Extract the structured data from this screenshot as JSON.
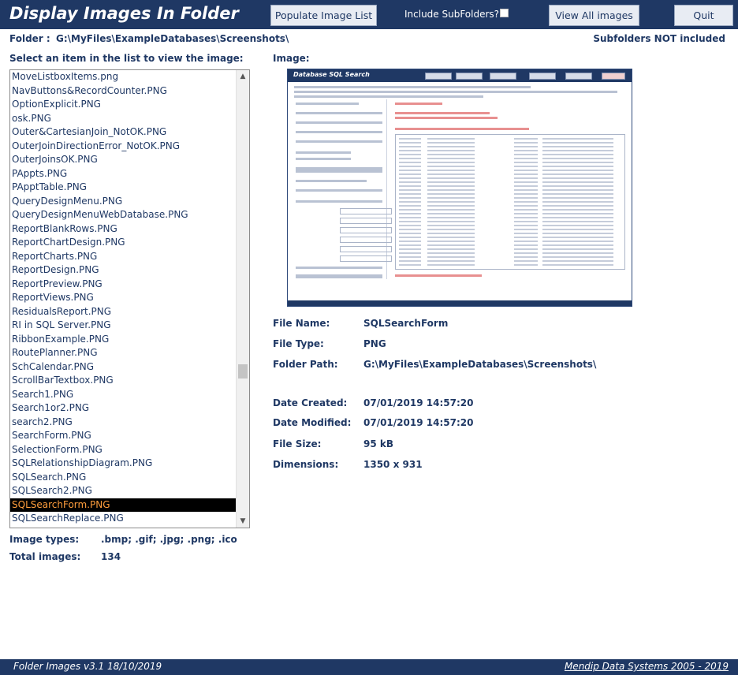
{
  "header": {
    "title": "Display Images In Folder",
    "populate_label": "Populate Image List",
    "include_subfolders_label": "Include SubFolders?",
    "include_subfolders_checked": false,
    "view_all_label": "View All images",
    "quit_label": "Quit"
  },
  "folder": {
    "label": "Folder :",
    "path": "G:\\MyFiles\\ExampleDatabases\\Screenshots\\",
    "subfolder_status": "Subfolders NOT included"
  },
  "list": {
    "label": "Select an item in the list to view the image:",
    "items": [
      "MoveListboxItems.png",
      "NavButtons&RecordCounter.PNG",
      "OptionExplicit.PNG",
      "osk.PNG",
      "Outer&CartesianJoin_NotOK.PNG",
      "OuterJoinDirectionError_NotOK.PNG",
      "OuterJoinsOK.PNG",
      "PAppts.PNG",
      "PApptTable.PNG",
      "QueryDesignMenu.PNG",
      "QueryDesignMenuWebDatabase.PNG",
      "ReportBlankRows.PNG",
      "ReportChartDesign.PNG",
      "ReportCharts.PNG",
      "ReportDesign.PNG",
      "ReportPreview.PNG",
      "ReportViews.PNG",
      "ResidualsReport.PNG",
      "RI in SQL Server.PNG",
      "RibbonExample.PNG",
      "RoutePlanner.PNG",
      "SchCalendar.PNG",
      "ScrollBarTextbox.PNG",
      "Search1.PNG",
      "Search1or2.PNG",
      "search2.PNG",
      "SearchForm.PNG",
      "SelectionForm.PNG",
      "SQLRelationshipDiagram.PNG",
      "SQLSearch.PNG",
      "SQLSearch2.PNG",
      "SQLSearchForm.PNG",
      "SQLSearchReplace.PNG"
    ],
    "selected_index": 31
  },
  "image": {
    "label": "Image:",
    "preview_title": "Database SQL Search"
  },
  "details": {
    "file_name_label": "File Name:",
    "file_name": "SQLSearchForm",
    "file_type_label": "File Type:",
    "file_type": "PNG",
    "folder_path_label": "Folder Path:",
    "folder_path": "G:\\MyFiles\\ExampleDatabases\\Screenshots\\",
    "date_created_label": "Date Created:",
    "date_created": "07/01/2019 14:57:20",
    "date_modified_label": "Date Modified:",
    "date_modified": "07/01/2019 14:57:20",
    "file_size_label": "File Size:",
    "file_size": "95 kB",
    "dimensions_label": "Dimensions:",
    "dimensions": "1350 x 931"
  },
  "summary": {
    "image_types_label": "Image types:",
    "image_types": ".bmp; .gif; .jpg; .png; .ico",
    "total_images_label": "Total images:",
    "total_images": "134"
  },
  "footer": {
    "version": "Folder Images v3.1  18/10/2019",
    "company": "Mendip Data Systems 2005 - 2019"
  },
  "colors": {
    "brand": "#1f3864",
    "selection_bg": "#000000",
    "selection_text": "#ff9e3d"
  }
}
